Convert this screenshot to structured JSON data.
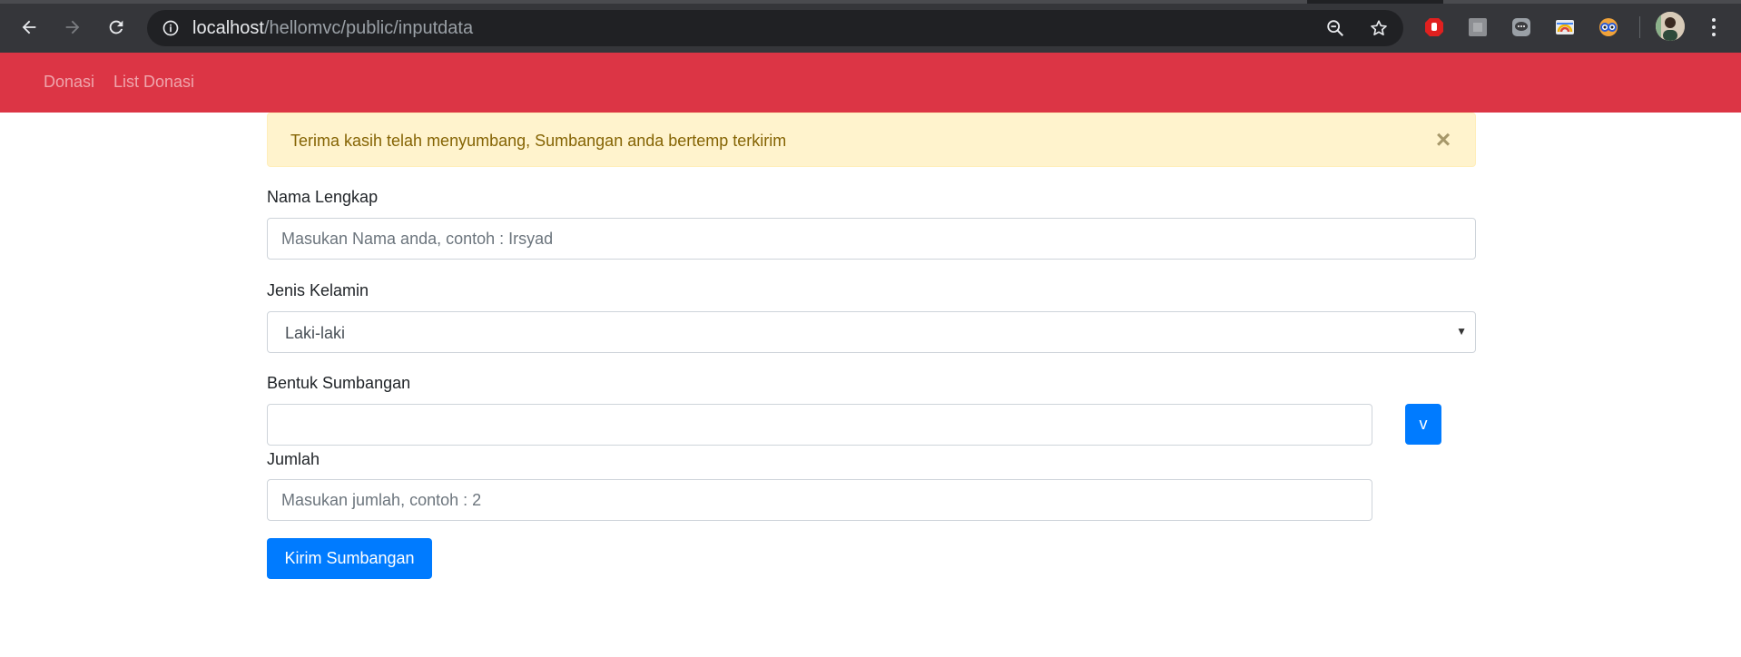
{
  "browser": {
    "url_host": "localhost",
    "url_path": "/hellomvc/public/inputdata",
    "icons": [
      "back-icon",
      "forward-icon",
      "reload-icon",
      "site-info-icon",
      "zoom-out-icon",
      "bookmark-star-icon",
      "extension-stop-icon",
      "extension-grey-icon",
      "extension-chat-icon",
      "extension-rainbow-icon",
      "extension-glasses-icon",
      "profile-avatar-icon",
      "menu-kebab-icon"
    ]
  },
  "navbar": {
    "links": [
      {
        "label": "Donasi"
      },
      {
        "label": "List Donasi"
      }
    ],
    "color": "#dc3545"
  },
  "alert": {
    "message": "Terima kasih telah menyumbang, Sumbangan anda bertemp terkirim",
    "close": "×"
  },
  "form": {
    "nama": {
      "label": "Nama Lengkap",
      "placeholder": "Masukan Nama anda, contoh : Irsyad",
      "value": ""
    },
    "jenis_kelamin": {
      "label": "Jenis Kelamin",
      "selected": "Laki-laki"
    },
    "bentuk": {
      "label": "Bentuk Sumbangan",
      "value": "",
      "button": "v"
    },
    "jumlah": {
      "label": "Jumlah",
      "placeholder": "Masukan jumlah, contoh : 2",
      "value": ""
    },
    "submit": "Kirim Sumbangan"
  },
  "colors": {
    "primary": "#007bff",
    "alert_bg": "#fff3cd",
    "alert_text": "#856404"
  }
}
